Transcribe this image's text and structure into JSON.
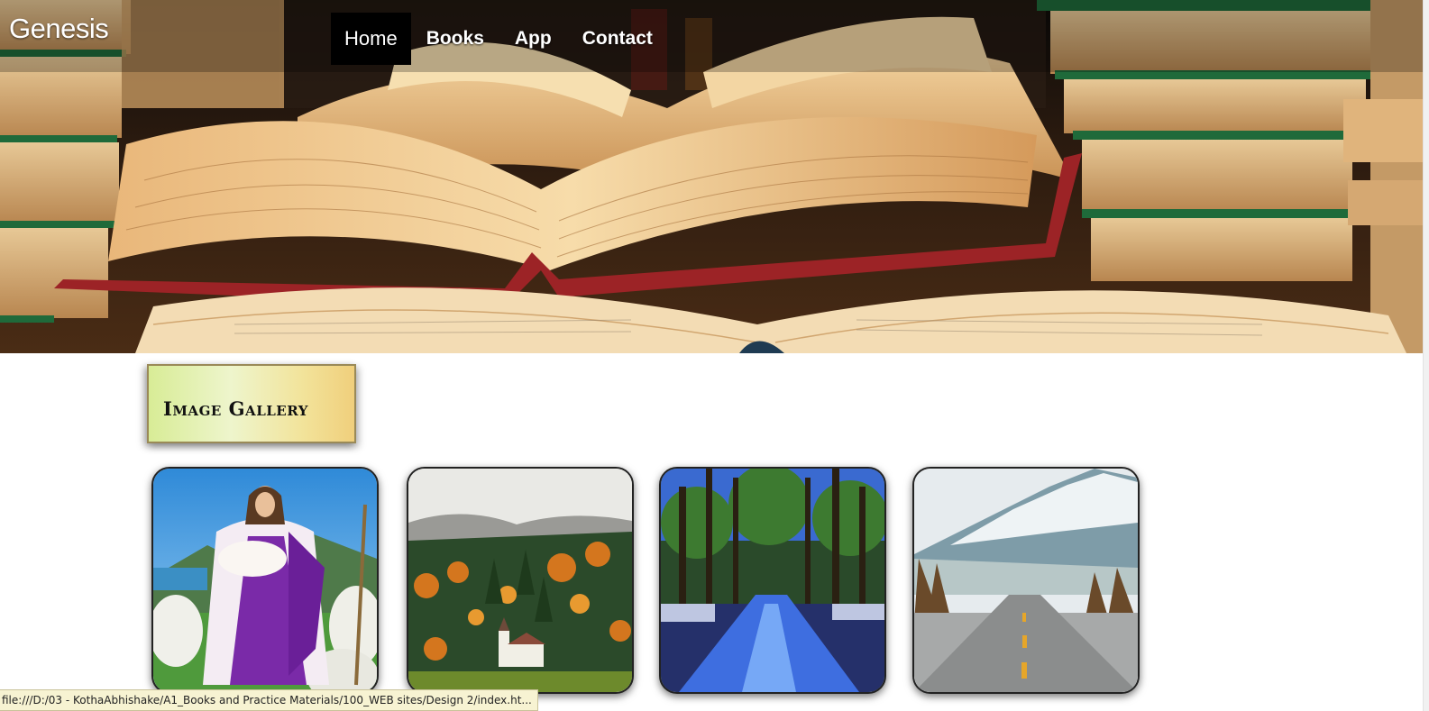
{
  "header": {
    "brand": "Genesis",
    "nav": [
      {
        "label": "Home",
        "active": true
      },
      {
        "label": "Books",
        "active": false
      },
      {
        "label": "App",
        "active": false
      },
      {
        "label": "Contact",
        "active": false
      }
    ]
  },
  "gallery": {
    "title": "Image Gallery",
    "images": [
      {
        "subject": "shepherd-with-lamb"
      },
      {
        "subject": "autumn-forest-chapel"
      },
      {
        "subject": "blue-forest-road"
      },
      {
        "subject": "mountain-highway"
      }
    ]
  },
  "status_bar": {
    "text": "file:///D:/03 - KothaAbhishake/A1_Books and Practice Materials/100_WEB sites/Design 2/index.ht..."
  },
  "colors": {
    "nav_active_bg": "#000000",
    "title_gradient_start": "#d8ec96",
    "title_gradient_end": "#f0cf7c",
    "status_bar_bg": "#f7f3d2"
  }
}
